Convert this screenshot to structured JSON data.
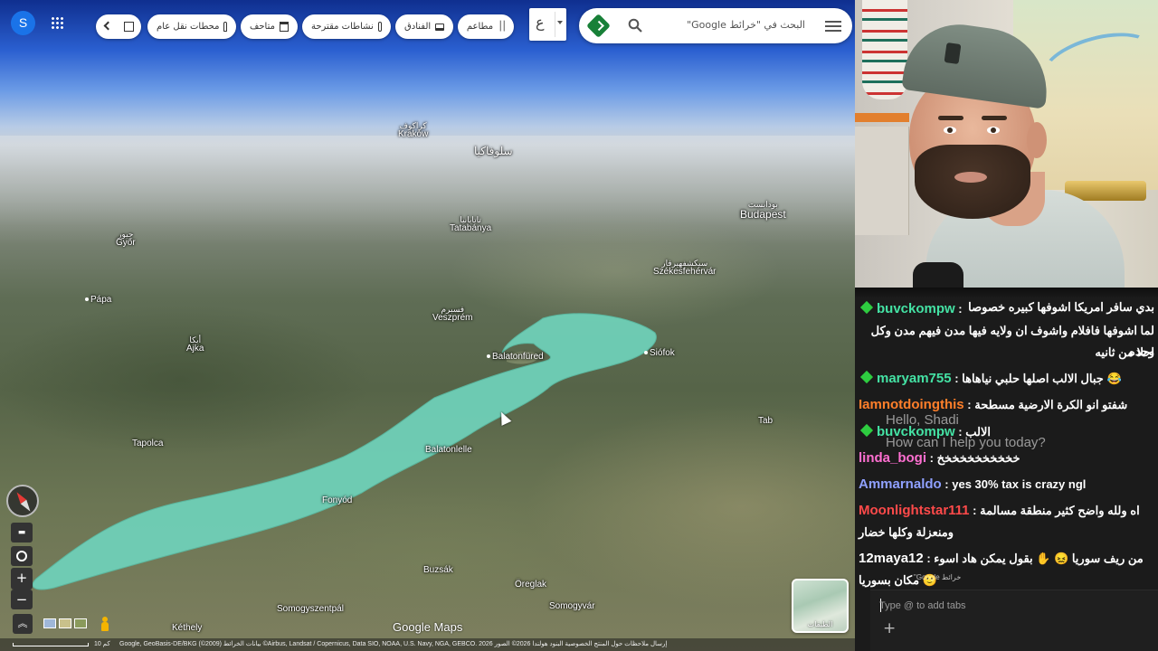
{
  "map": {
    "account_initial": "S",
    "search_placeholder": "البحث في \"خرائط Google\"",
    "language_glyph": "ع",
    "chips": [
      {
        "label": "مطاعم",
        "icon": "restaurant-icon"
      },
      {
        "label": "الفنادق",
        "icon": "hotel-icon"
      },
      {
        "label": "نشاطات مقترحة",
        "icon": "camera-icon"
      },
      {
        "label": "متاحف",
        "icon": "museum-icon"
      },
      {
        "label": "محطات نقل عام",
        "icon": "transit-icon"
      }
    ],
    "places": {
      "krakow_ar": "كراكوف",
      "krakow_en": "Kraków",
      "slovakia": "سلوفاكيا",
      "budapest_ar": "بودابست",
      "budapest_en": "Budapest",
      "gyor_ar": "جيور",
      "gyor_en": "Győr",
      "tatabanya_ar": "تاتابانيا",
      "tatabanya_en": "Tatabánya",
      "szekes_ar": "سيكشفهيرفار",
      "szekes_en": "Székesfehérvár",
      "papa": "Pápa",
      "veszprem_ar": "فسبرم",
      "veszprem_en": "Veszprém",
      "ajka_ar": "أيكا",
      "ajka_en": "Ajka",
      "balatonfured": "Balatonfüred",
      "siofok": "Siófok",
      "tab": "Tab",
      "tapolca": "Tapolca",
      "balatonlelle": "Balatonlelle",
      "fonyod": "Fonyód",
      "buzsak": "Buzsák",
      "oreglak": "Öreglak",
      "somogyvar": "Somogyvár",
      "somogyszentpal": "Somogyszentpál",
      "kethely": "Kéthely"
    },
    "layers_label": "الطبقات",
    "logo_text": "Google Maps",
    "scale_label": "10 كم",
    "attribution": "إرسال ملاحظات حول المنتج   الخصوصية   البنود   هولندا   2026© الصور Airbus, Landsat / Copernicus, Data SIO, NOAA, U.S. Navy, NGA, GEBCO. 2026© بيانات الخرائط Google, GeoBasis-DE/BKG (©2009)",
    "colors": {
      "lake": "#6fd0b8",
      "sky_top": "#0f2f8f",
      "account": "#1a73e8"
    }
  },
  "chat": {
    "messages": [
      {
        "user": "",
        "text": "بدي سافر امريكا اشوفها كبيره خصوصا"
      },
      {
        "user": "buvckompw",
        "text": ""
      },
      {
        "user": "",
        "text": "لما اشوفها فافلام واشوف ان ولايه فيها مدن فيهم مدن وكل وحده"
      },
      {
        "user": "",
        "text": "احلا من ثانيه"
      },
      {
        "user": "maryam755",
        "text": "جبال الالب اصلها حلبي نياهاها 😂"
      },
      {
        "user": "Iamnotdoingthis",
        "text": "شفتو انو الكرة الارضية مسطحة"
      },
      {
        "user": "buvckompw",
        "text": "الالب"
      },
      {
        "user": "linda_bogi",
        "text": "خخخخخخخخخخخ"
      },
      {
        "user": "Ammarnaldo",
        "text": "yes 30% tax is crazy ngl"
      },
      {
        "user": "Moonlightstar111",
        "text": "اه ولله واضح كثير منطقة مسالمة"
      },
      {
        "user": "",
        "text": "ومنعزلة وكلها خضار"
      },
      {
        "user": "12maya12",
        "text": "من ريف سوريا 😖 ✋ بقول يمكن هاد اسوء"
      },
      {
        "user": "",
        "text": "مكان بسوريا 🙂"
      }
    ],
    "ghost_greeting": "Hello, Shadi",
    "ghost_question": "How can I help you today?",
    "ghost_google": "خرائط Google\"",
    "input_placeholder": "Type @ to add tabs",
    "add_label": "+"
  }
}
